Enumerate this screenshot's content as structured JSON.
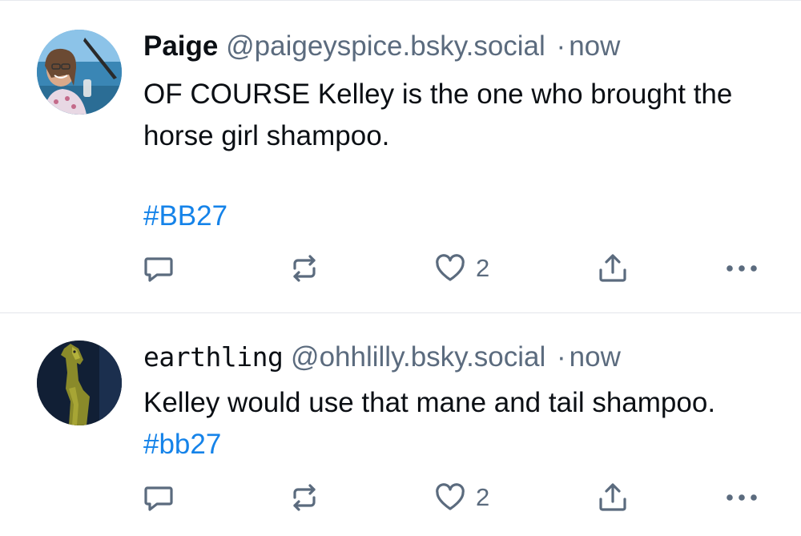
{
  "colors": {
    "text": "#0b0f14",
    "secondary": "#5b6b7e",
    "link": "#1583e9",
    "divider": "#e3e6ea"
  },
  "posts": [
    {
      "display_name": "Paige",
      "handle": "@paigeyspice.bsky.social",
      "separator": "·",
      "time": "now",
      "text": "OF COURSE Kelley is the one who brought the horse girl shampoo.",
      "hashtag": "#BB27",
      "avatar": "woman-on-boat-photo",
      "actions": {
        "reply_icon": "reply-icon",
        "repost_icon": "repost-icon",
        "like_icon": "heart-icon",
        "like_count": "2",
        "share_icon": "share-icon",
        "more_icon": "more-icon"
      }
    },
    {
      "display_name": "earthling",
      "handle": "@ohhlilly.bsky.social",
      "separator": "·",
      "time": "now",
      "text": "Kelley would use that mane and tail shampoo.",
      "hashtag": "#bb27",
      "avatar": "gold-dog-statue-photo",
      "actions": {
        "reply_icon": "reply-icon",
        "repost_icon": "repost-icon",
        "like_icon": "heart-icon",
        "like_count": "2",
        "share_icon": "share-icon",
        "more_icon": "more-icon"
      }
    }
  ]
}
